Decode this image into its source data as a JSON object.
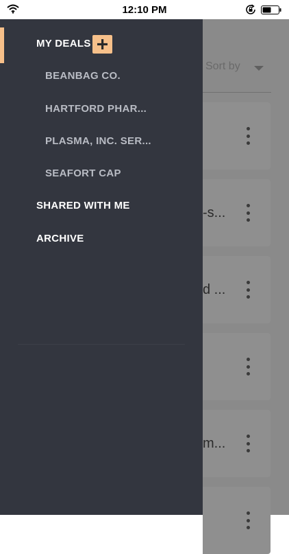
{
  "status_bar": {
    "time": "12:10 PM"
  },
  "drawer": {
    "my_deals": "MY DEALS",
    "deals": [
      {
        "label": "BEANBAG CO."
      },
      {
        "label": "HARTFORD PHAR..."
      },
      {
        "label": "PLASMA, INC. SER..."
      },
      {
        "label": "SEAFORT CAP"
      }
    ],
    "shared": "SHARED WITH ME",
    "archive": "ARCHIVE"
  },
  "main": {
    "sort_label": "Sort by",
    "cards": [
      {
        "text": ""
      },
      {
        "text": "-s..."
      },
      {
        "text": "d ..."
      },
      {
        "text": ""
      },
      {
        "text": "m..."
      },
      {
        "text": ""
      }
    ]
  },
  "colors": {
    "drawer_bg": "#33363f",
    "accent": "#f7c08a",
    "overlay": "#8a8a8a"
  }
}
